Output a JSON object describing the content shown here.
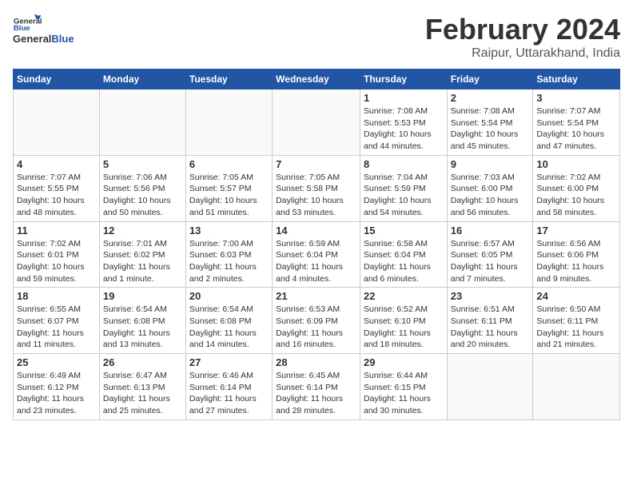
{
  "logo": {
    "general": "General",
    "blue": "Blue"
  },
  "header": {
    "month": "February 2024",
    "location": "Raipur, Uttarakhand, India"
  },
  "weekdays": [
    "Sunday",
    "Monday",
    "Tuesday",
    "Wednesday",
    "Thursday",
    "Friday",
    "Saturday"
  ],
  "weeks": [
    [
      {
        "day": "",
        "info": ""
      },
      {
        "day": "",
        "info": ""
      },
      {
        "day": "",
        "info": ""
      },
      {
        "day": "",
        "info": ""
      },
      {
        "day": "1",
        "info": "Sunrise: 7:08 AM\nSunset: 5:53 PM\nDaylight: 10 hours\nand 44 minutes."
      },
      {
        "day": "2",
        "info": "Sunrise: 7:08 AM\nSunset: 5:54 PM\nDaylight: 10 hours\nand 45 minutes."
      },
      {
        "day": "3",
        "info": "Sunrise: 7:07 AM\nSunset: 5:54 PM\nDaylight: 10 hours\nand 47 minutes."
      }
    ],
    [
      {
        "day": "4",
        "info": "Sunrise: 7:07 AM\nSunset: 5:55 PM\nDaylight: 10 hours\nand 48 minutes."
      },
      {
        "day": "5",
        "info": "Sunrise: 7:06 AM\nSunset: 5:56 PM\nDaylight: 10 hours\nand 50 minutes."
      },
      {
        "day": "6",
        "info": "Sunrise: 7:05 AM\nSunset: 5:57 PM\nDaylight: 10 hours\nand 51 minutes."
      },
      {
        "day": "7",
        "info": "Sunrise: 7:05 AM\nSunset: 5:58 PM\nDaylight: 10 hours\nand 53 minutes."
      },
      {
        "day": "8",
        "info": "Sunrise: 7:04 AM\nSunset: 5:59 PM\nDaylight: 10 hours\nand 54 minutes."
      },
      {
        "day": "9",
        "info": "Sunrise: 7:03 AM\nSunset: 6:00 PM\nDaylight: 10 hours\nand 56 minutes."
      },
      {
        "day": "10",
        "info": "Sunrise: 7:02 AM\nSunset: 6:00 PM\nDaylight: 10 hours\nand 58 minutes."
      }
    ],
    [
      {
        "day": "11",
        "info": "Sunrise: 7:02 AM\nSunset: 6:01 PM\nDaylight: 10 hours\nand 59 minutes."
      },
      {
        "day": "12",
        "info": "Sunrise: 7:01 AM\nSunset: 6:02 PM\nDaylight: 11 hours\nand 1 minute."
      },
      {
        "day": "13",
        "info": "Sunrise: 7:00 AM\nSunset: 6:03 PM\nDaylight: 11 hours\nand 2 minutes."
      },
      {
        "day": "14",
        "info": "Sunrise: 6:59 AM\nSunset: 6:04 PM\nDaylight: 11 hours\nand 4 minutes."
      },
      {
        "day": "15",
        "info": "Sunrise: 6:58 AM\nSunset: 6:04 PM\nDaylight: 11 hours\nand 6 minutes."
      },
      {
        "day": "16",
        "info": "Sunrise: 6:57 AM\nSunset: 6:05 PM\nDaylight: 11 hours\nand 7 minutes."
      },
      {
        "day": "17",
        "info": "Sunrise: 6:56 AM\nSunset: 6:06 PM\nDaylight: 11 hours\nand 9 minutes."
      }
    ],
    [
      {
        "day": "18",
        "info": "Sunrise: 6:55 AM\nSunset: 6:07 PM\nDaylight: 11 hours\nand 11 minutes."
      },
      {
        "day": "19",
        "info": "Sunrise: 6:54 AM\nSunset: 6:08 PM\nDaylight: 11 hours\nand 13 minutes."
      },
      {
        "day": "20",
        "info": "Sunrise: 6:54 AM\nSunset: 6:08 PM\nDaylight: 11 hours\nand 14 minutes."
      },
      {
        "day": "21",
        "info": "Sunrise: 6:53 AM\nSunset: 6:09 PM\nDaylight: 11 hours\nand 16 minutes."
      },
      {
        "day": "22",
        "info": "Sunrise: 6:52 AM\nSunset: 6:10 PM\nDaylight: 11 hours\nand 18 minutes."
      },
      {
        "day": "23",
        "info": "Sunrise: 6:51 AM\nSunset: 6:11 PM\nDaylight: 11 hours\nand 20 minutes."
      },
      {
        "day": "24",
        "info": "Sunrise: 6:50 AM\nSunset: 6:11 PM\nDaylight: 11 hours\nand 21 minutes."
      }
    ],
    [
      {
        "day": "25",
        "info": "Sunrise: 6:49 AM\nSunset: 6:12 PM\nDaylight: 11 hours\nand 23 minutes."
      },
      {
        "day": "26",
        "info": "Sunrise: 6:47 AM\nSunset: 6:13 PM\nDaylight: 11 hours\nand 25 minutes."
      },
      {
        "day": "27",
        "info": "Sunrise: 6:46 AM\nSunset: 6:14 PM\nDaylight: 11 hours\nand 27 minutes."
      },
      {
        "day": "28",
        "info": "Sunrise: 6:45 AM\nSunset: 6:14 PM\nDaylight: 11 hours\nand 28 minutes."
      },
      {
        "day": "29",
        "info": "Sunrise: 6:44 AM\nSunset: 6:15 PM\nDaylight: 11 hours\nand 30 minutes."
      },
      {
        "day": "",
        "info": ""
      },
      {
        "day": "",
        "info": ""
      }
    ]
  ]
}
